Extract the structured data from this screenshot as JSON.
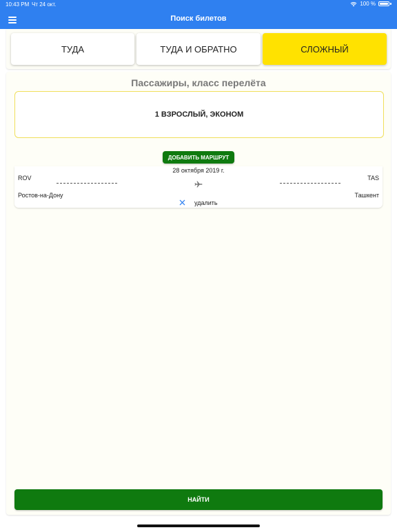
{
  "status_bar": {
    "time": "10:43 PM",
    "date": "Чт 24 окт.",
    "battery": "100 %"
  },
  "nav": {
    "title": "Поиск билетов",
    "menu_icon": "hamburger-menu-icon"
  },
  "tabs": [
    {
      "label": "ТУДА",
      "active": false
    },
    {
      "label": "ТУДА И ОБРАТНО",
      "active": false
    },
    {
      "label": "СЛОЖНЫЙ",
      "active": true
    }
  ],
  "passengers": {
    "section_title": "Пассажиры, класс перелёта",
    "value": "1 ВЗРОСЛЫЙ, ЭКОНОМ"
  },
  "add_route_label": "ДОБАВИТЬ МАРШРУТ",
  "routes": [
    {
      "date": "28 октября 2019 г.",
      "from_code": "ROV",
      "to_code": "TAS",
      "from_city": "Ростов-на-Дону",
      "to_city": "Ташкент",
      "delete_label": "удалить"
    }
  ],
  "find_label": "НАЙТИ",
  "colors": {
    "header": "#2f80f0",
    "active_tab": "#ffe200",
    "primary_button": "#0f7a0f",
    "delete_icon": "#2f80f0"
  }
}
